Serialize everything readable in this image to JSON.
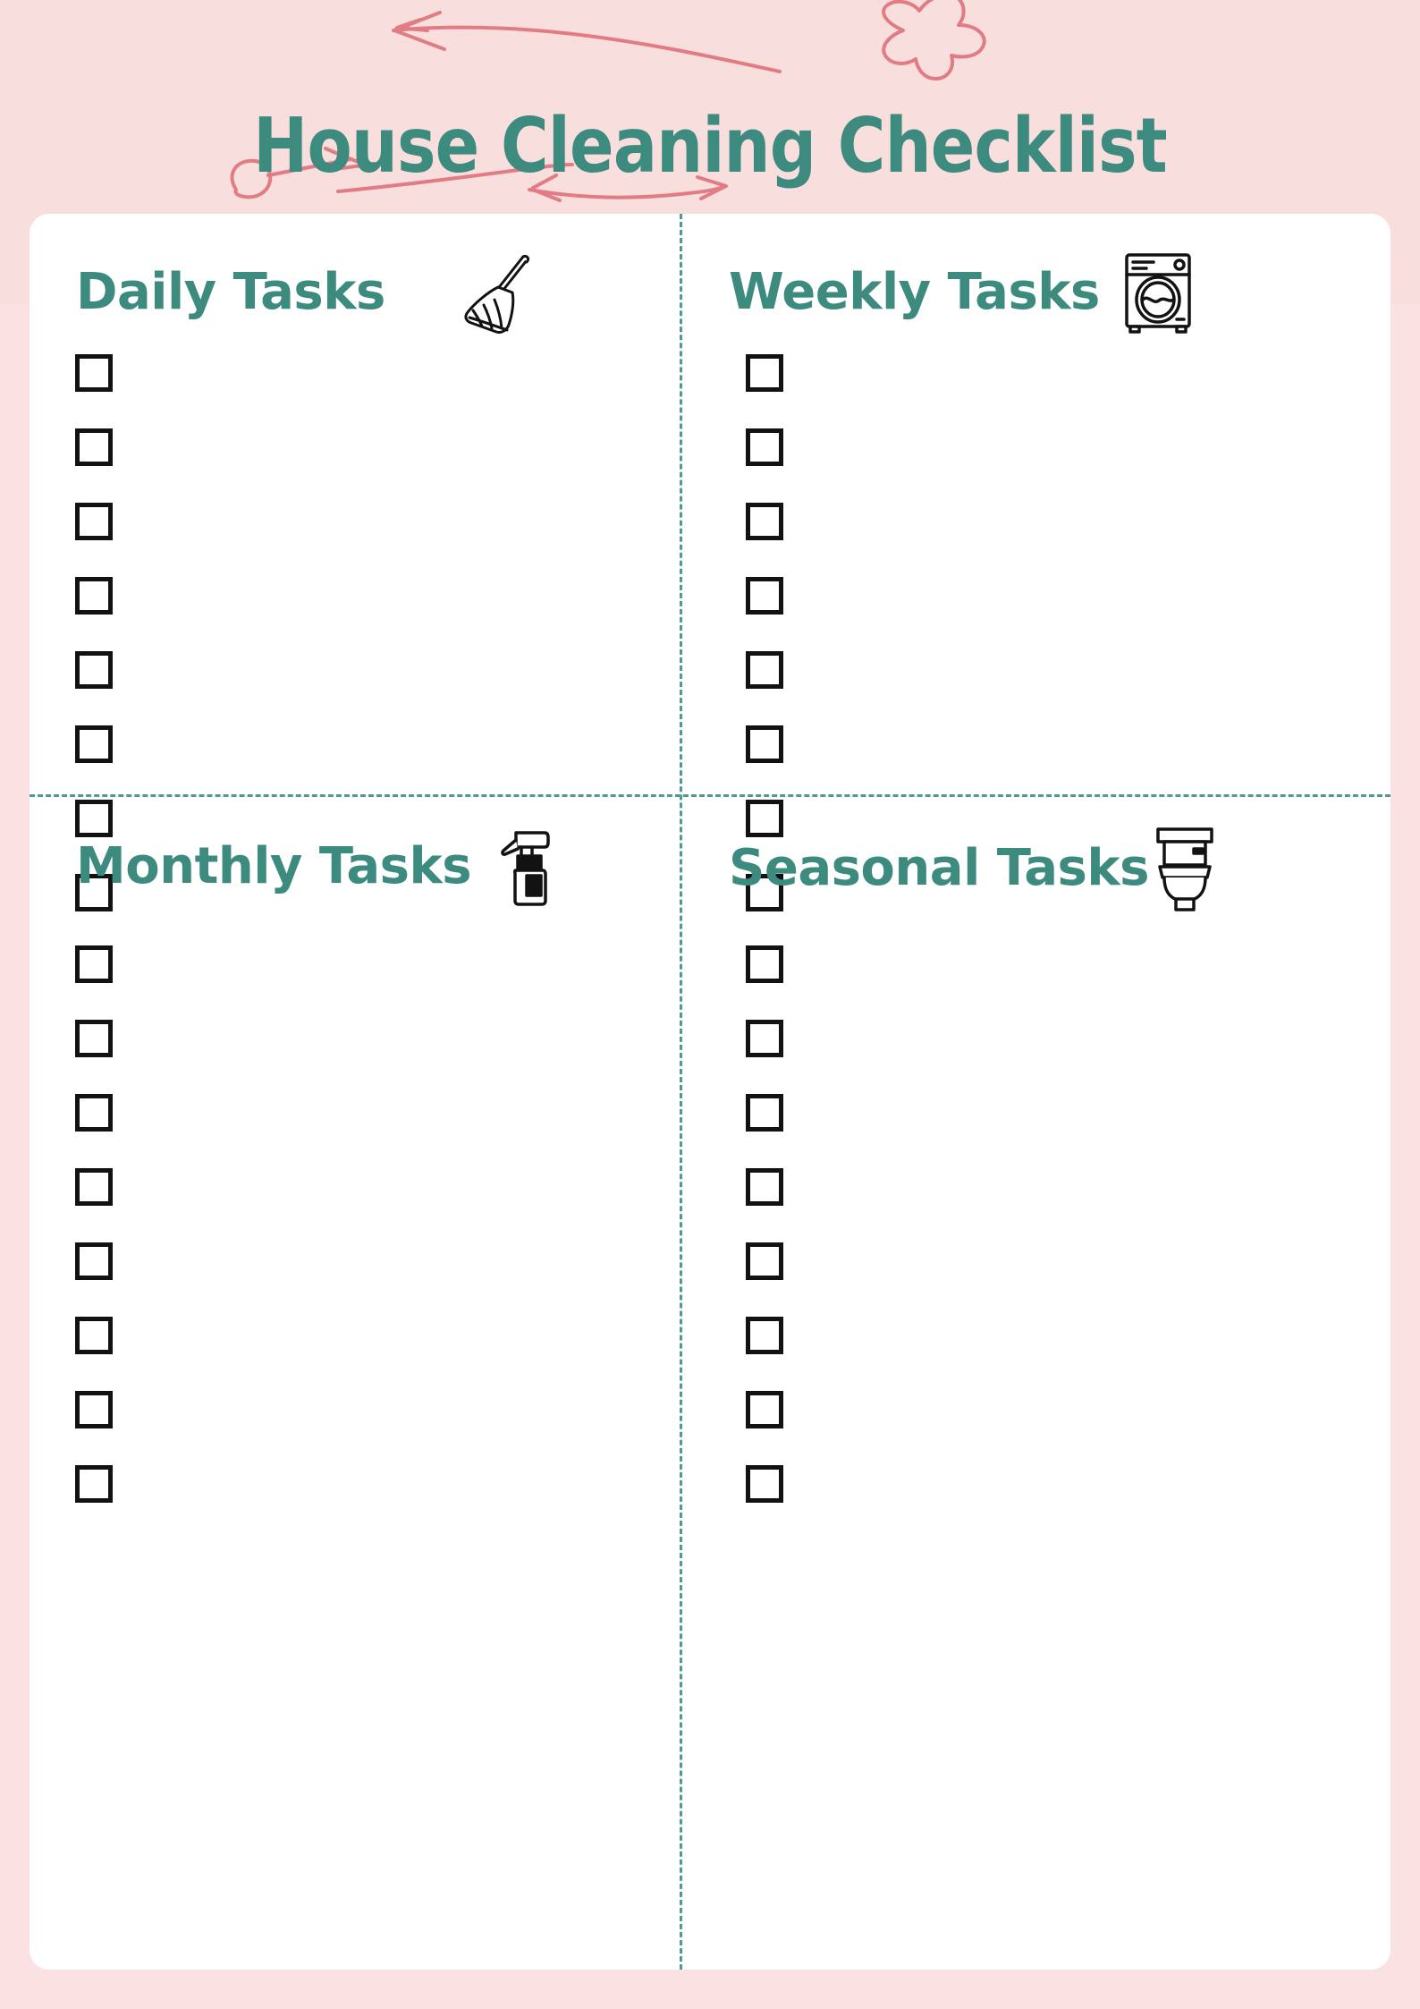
{
  "header": {
    "title": "House Cleaning Checklist",
    "background_color": "#F9DEDE",
    "title_color": "#3D8A7F",
    "doodle_color": "#E27C84",
    "doodles": [
      {
        "name": "arrow-left-doodle"
      },
      {
        "name": "flower-doodle"
      },
      {
        "name": "arrow-right-doodle"
      },
      {
        "name": "arrow-squiggle-doodle"
      }
    ]
  },
  "page": {
    "background_color": "#FBE2E2",
    "card_color": "#FFFFFF",
    "divider_color": "#4E9A8F",
    "checkbox_border_color": "#121212"
  },
  "sections": [
    {
      "id": "daily",
      "title": "Daily Tasks",
      "icon": "broom-icon",
      "checkbox_count": 8,
      "items": [
        "",
        "",
        "",
        "",
        "",
        "",
        "",
        ""
      ]
    },
    {
      "id": "weekly",
      "title": "Weekly Tasks",
      "icon": "washing-machine-icon",
      "checkbox_count": 8,
      "items": [
        "",
        "",
        "",
        "",
        "",
        "",
        "",
        ""
      ]
    },
    {
      "id": "monthly",
      "title": "Monthly Tasks",
      "icon": "spray-bottle-icon",
      "checkbox_count": 8,
      "items": [
        "",
        "",
        "",
        "",
        "",
        "",
        "",
        ""
      ]
    },
    {
      "id": "seasonal",
      "title": "Seasonal Tasks",
      "icon": "toilet-icon",
      "checkbox_count": 8,
      "items": [
        "",
        "",
        "",
        "",
        "",
        "",
        "",
        ""
      ]
    }
  ]
}
